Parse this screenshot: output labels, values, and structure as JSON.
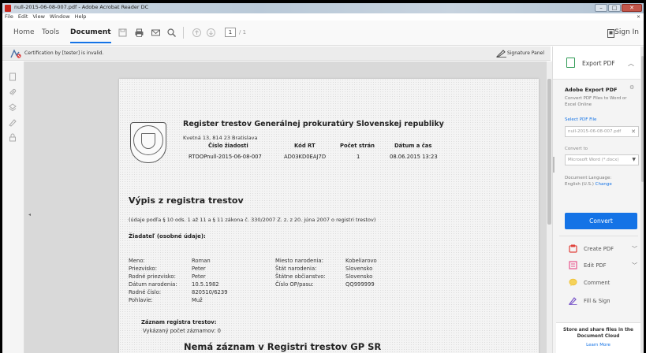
{
  "window": {
    "title": "null-2015-06-08-007.pdf - Adobe Acrobat Reader DC",
    "buttons": {
      "minimize": "–",
      "maximize": "□",
      "close": "✕"
    }
  },
  "menu": {
    "items": [
      "File",
      "Edit",
      "View",
      "Window",
      "Help"
    ],
    "close_x": "×"
  },
  "toolbar": {
    "tabs": [
      "Home",
      "Tools",
      "Document"
    ],
    "page_current": "1",
    "page_total": "/ 1",
    "sign_in": "Sign In"
  },
  "certbar": {
    "message": "Certification by [tester] is invalid.",
    "signature_panel": "Signature Panel"
  },
  "document": {
    "title": "Register trestov Generálnej prokuratúry Slovenskej republiky",
    "address": "Kvetná 13, 814 23 Bratislava",
    "meta_labels": [
      "Číslo žiadosti",
      "Kód RT",
      "Počet strán",
      "Dátum a čas"
    ],
    "meta_values": [
      "RTOOPnull-2015-06-08-007",
      "AD03KD0EAJ7D",
      "1",
      "08.06.2015 13:23"
    ],
    "section_title": "Výpis z registra trestov",
    "legal_note": "(údaje podľa § 10 ods. 1 až 11 a § 11 zákona č. 330/2007 Z. z. z 20. júna 2007 o registri trestov)",
    "applicant_heading": "Žiadateľ (osobné údaje):",
    "personal_left_labels": [
      "Meno:",
      "Priezvisko:",
      "Rodné priezvisko:",
      "Dátum narodenia:",
      "Rodné číslo:",
      "Pohlavie:"
    ],
    "personal_left_values": [
      "Roman",
      "Peter",
      "Peter",
      "10.5.1982",
      "820510/6239",
      "Muž"
    ],
    "personal_right_labels": [
      "Miesto narodenia:",
      "Štát narodenia:",
      "Štátne občianstvo:",
      "Číslo OP/pasu:"
    ],
    "personal_right_values": [
      "Kobeliarovo",
      "Slovensko",
      "Slovensko",
      "QQ999999"
    ],
    "record_title": "Záznam registra trestov:",
    "record_count": "Vykázaný počet záznamov:   0",
    "no_record": "Nemá záznam v Registri trestov GP SR"
  },
  "right_panel": {
    "export_pdf": "Export PDF",
    "adobe_export_heading": "Adobe Export PDF",
    "description": "Convert PDF Files to Word or Excel Online",
    "select_pdf_file": "Select PDF File",
    "file_name": "null-2015-06-08-007.pdf",
    "convert_to_label": "Convert to",
    "convert_to_value": "Microsoft Word (*.docx)",
    "doc_language_label": "Document Language:",
    "doc_language_value": "English (U.S.)",
    "change_link": "Change",
    "convert_button": "Convert",
    "tools": [
      {
        "label": "Create PDF",
        "icon": "create-pdf-icon",
        "color": "#e0413a"
      },
      {
        "label": "Edit PDF",
        "icon": "edit-pdf-icon",
        "color": "#e8548c"
      },
      {
        "label": "Comment",
        "icon": "comment-icon",
        "color": "#f0c33c"
      },
      {
        "label": "Fill & Sign",
        "icon": "fill-sign-icon",
        "color": "#7a57c9"
      }
    ],
    "cloud_text": "Store and share files in the Document Cloud",
    "learn_more": "Learn More"
  },
  "colors": {
    "accent": "#1473e6",
    "export_green": "#2e9a54",
    "title_red": "#c8261c"
  }
}
